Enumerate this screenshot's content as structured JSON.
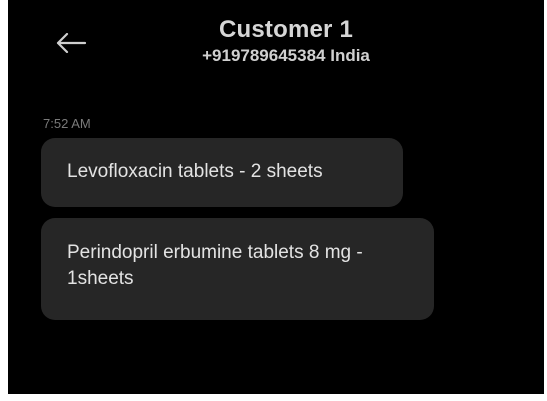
{
  "header": {
    "title": "Customer 1",
    "subtitle": "+919789645384 India",
    "back_icon": "arrow-left-icon"
  },
  "conversation": {
    "timestamp": "7:52 AM",
    "messages": [
      {
        "text": "Levofloxacin tablets - 2 sheets"
      },
      {
        "text": "Perindopril erbumine tablets 8 mg - 1sheets"
      }
    ]
  },
  "colors": {
    "background": "#000000",
    "bubble": "#262626",
    "text": "#e3e3e3",
    "timestamp": "#7a7a7a"
  }
}
